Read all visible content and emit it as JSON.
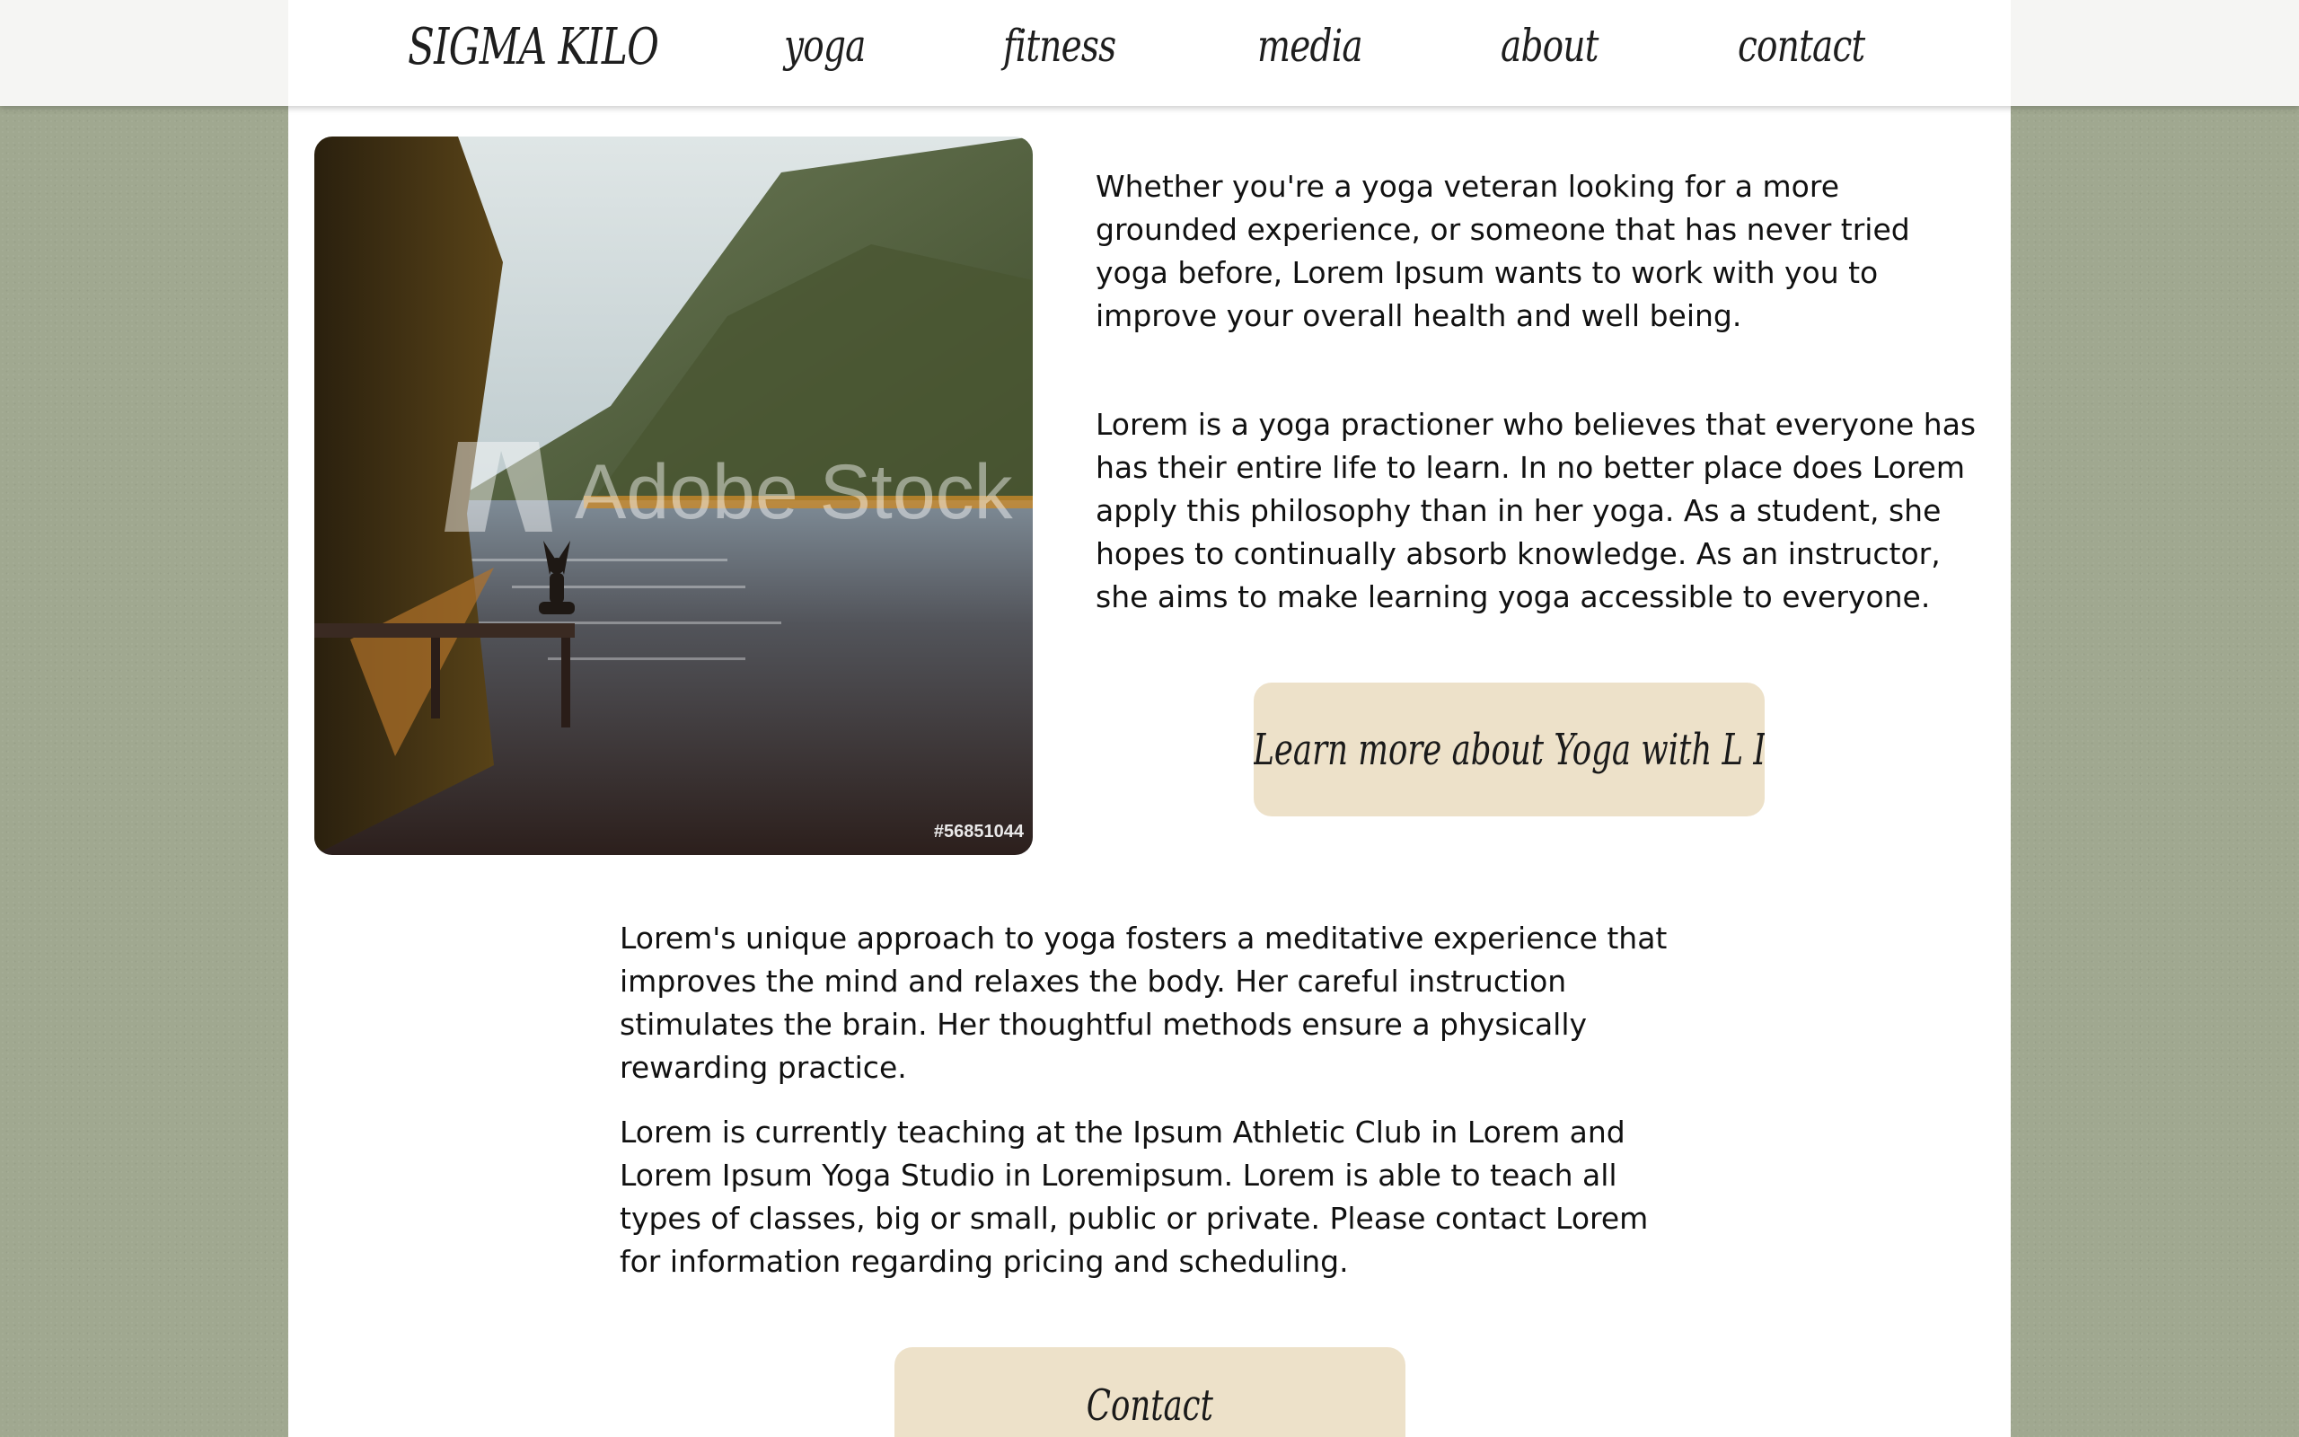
{
  "nav": {
    "brand": "SIGMA KILO",
    "links": [
      "yoga",
      "fitness",
      "media",
      "about",
      "contact"
    ]
  },
  "hero_image": {
    "watermark": "Adobe Stock",
    "stock_id": "#56851044"
  },
  "content": {
    "paragraph_1": "Whether you're a yoga veteran looking for a more grounded experience, or someone that has never tried yoga before, Lorem Ipsum wants to work with you to improve your overall health and well being.",
    "paragraph_2": "Lorem is a yoga practioner who believes that everyone has has their entire life to learn. In no better place does Lorem apply this philosophy than in her yoga. As a student, she hopes to continually absorb knowledge. As an instructor, she aims to make learning yoga accessible to everyone.",
    "learn_more_button": "Learn more about Yoga with L I",
    "paragraph_3": "Lorem's unique approach to yoga fosters a meditative experience that improves the mind and relaxes the body. Her careful instruction stimulates the brain. Her thoughtful methods ensure a physically rewarding practice.",
    "paragraph_4": "Lorem is currently teaching at the Ipsum Athletic Club in Lorem and Lorem Ipsum Yoga Studio in Loremipsum. Lorem is able to teach all types of classes, big or small, public or private. Please contact Lorem for information regarding pricing and scheduling.",
    "contact_button": "Contact"
  },
  "colors": {
    "background": "#a0a890",
    "page": "#ffffff",
    "button": "#ede1c9",
    "text": "#111111"
  }
}
